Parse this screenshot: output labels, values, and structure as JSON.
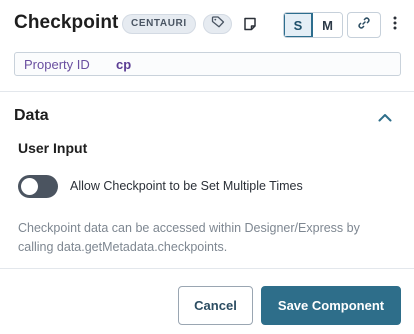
{
  "header": {
    "title": "Checkpoint",
    "badge": "CENTAURI",
    "size_options": [
      "S",
      "M"
    ],
    "active_size": "S"
  },
  "property": {
    "label": "Property ID",
    "value": "cp"
  },
  "section": {
    "title": "Data",
    "group_label": "User Input",
    "toggle_label": "Allow Checkpoint to be Set Multiple Times",
    "toggle_on": false,
    "help_text": "Checkpoint data can be accessed within Designer/Express by calling data.getMetadata.checkpoints."
  },
  "footer": {
    "cancel_label": "Cancel",
    "save_label": "Save Component"
  },
  "colors": {
    "primary": "#2e6e8a",
    "toggle_off": "#4b5460",
    "property_text": "#6a4fa0"
  }
}
